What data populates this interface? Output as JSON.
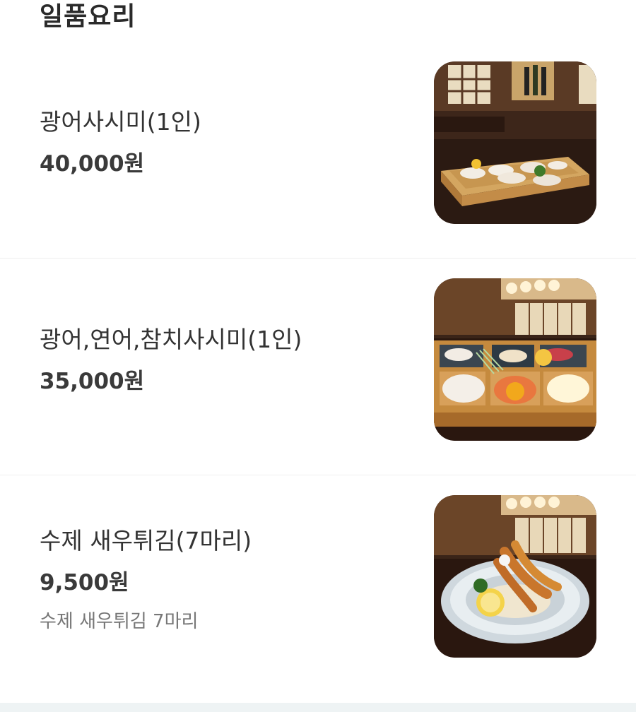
{
  "section": {
    "title": "일품요리"
  },
  "menu": {
    "items": [
      {
        "name": "광어사시미(1인)",
        "price": "40,000원",
        "image_icon": "sashimi-box-photo"
      },
      {
        "name": "광어,연어,참치사시미(1인)",
        "price": "35,000원",
        "image_icon": "mixed-sashimi-photo"
      },
      {
        "name": "수제 새우튀김(7마리)",
        "price": "9,500원",
        "description": "수제 새우튀김 7마리",
        "image_icon": "fried-shrimp-photo"
      }
    ]
  },
  "colors": {
    "wood": "#b8863f",
    "dark_wood": "#3b2418",
    "background": "#ffffff"
  }
}
